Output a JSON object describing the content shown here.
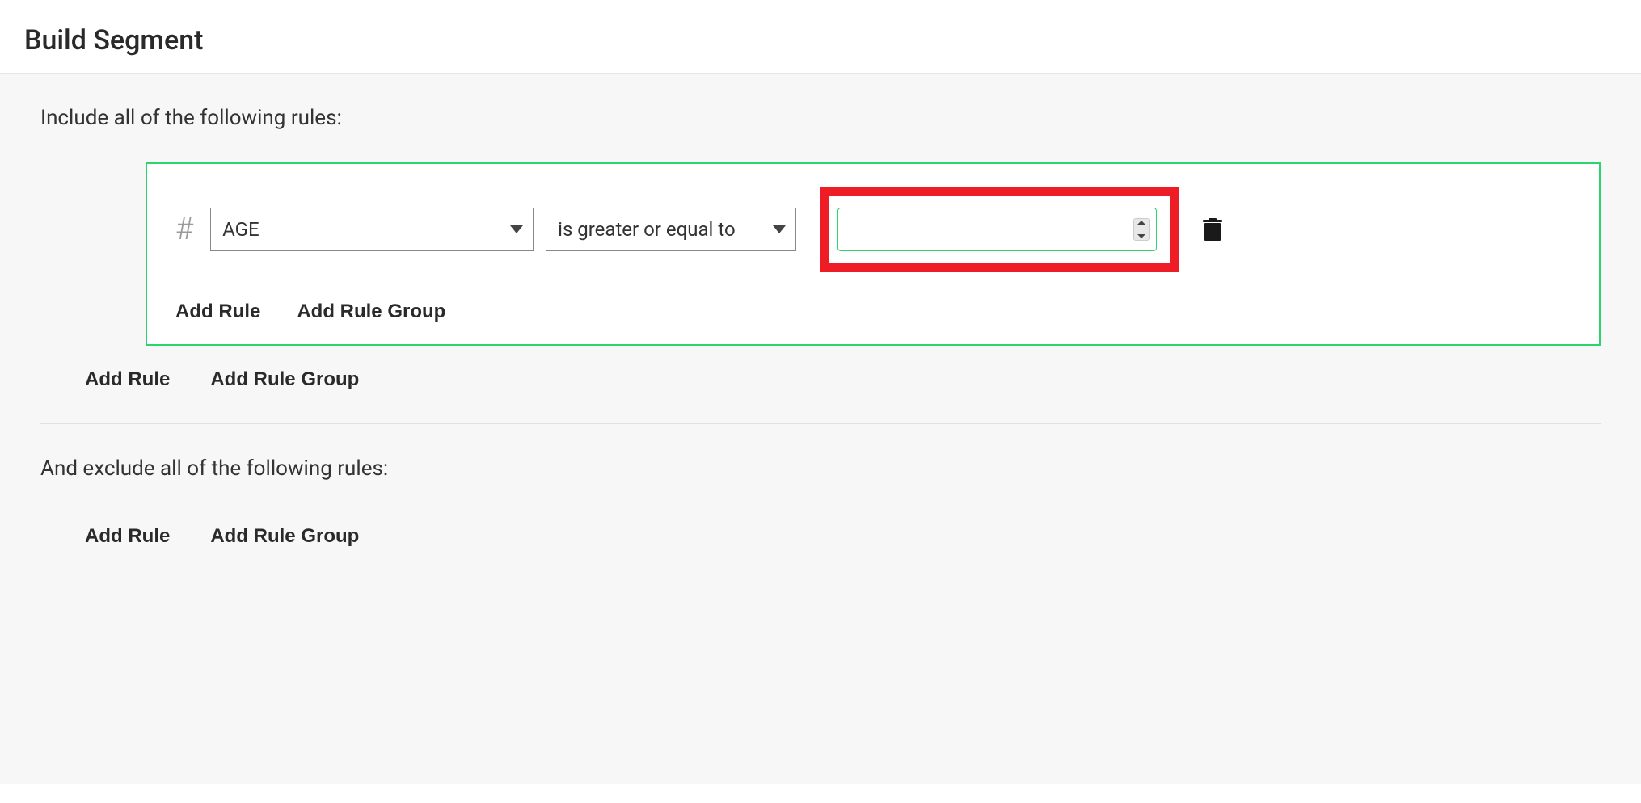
{
  "page_title": "Build Segment",
  "include": {
    "label": "Include all of the following rules:",
    "group": {
      "rule": {
        "field": "AGE",
        "operator": "is greater or equal to",
        "value": ""
      },
      "add_rule_label": "Add Rule",
      "add_group_label": "Add Rule Group"
    },
    "add_rule_label": "Add Rule",
    "add_group_label": "Add Rule Group"
  },
  "exclude": {
    "label": "And exclude all of the following rules:",
    "add_rule_label": "Add Rule",
    "add_group_label": "Add Rule Group"
  }
}
